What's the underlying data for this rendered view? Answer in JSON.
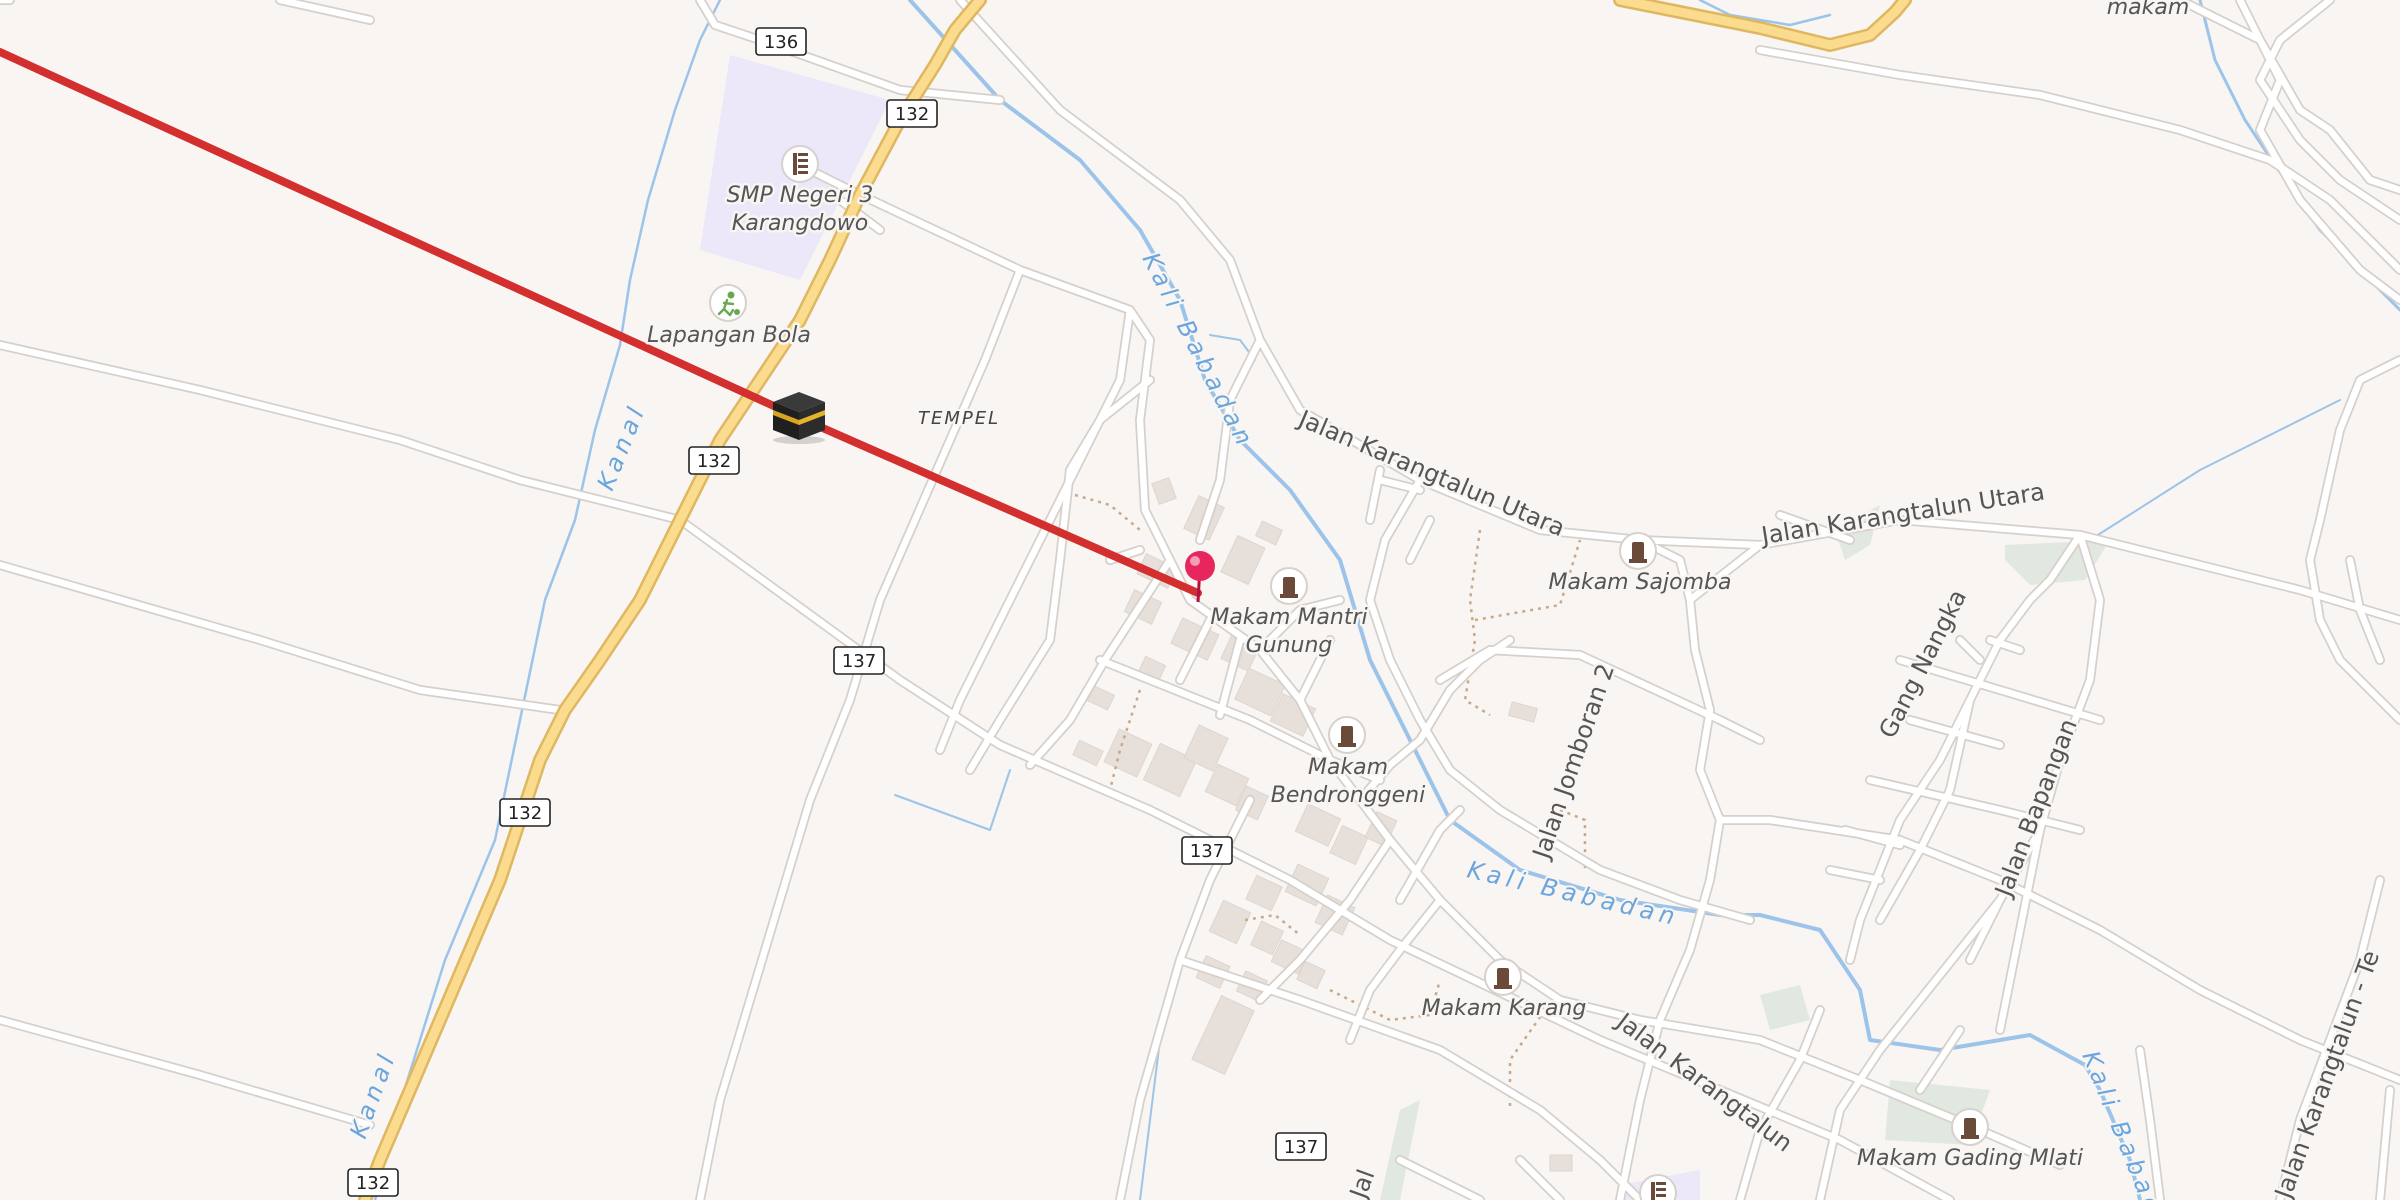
{
  "map": {
    "colors": {
      "background": "#f8f5f2",
      "road": "#ffffff",
      "road_casing": "#d6d0cb",
      "primary_road": "#fbdc8f",
      "primary_road_casing": "#e0b761",
      "water": "#9cc4ea",
      "route_line": "#d32f2f",
      "school_area": "#ece7f9",
      "park_area": "#e1e8df",
      "building": "#e7e0da",
      "pin": "#e8265e"
    },
    "labels": {
      "school": "SMP Negeri 3 Karangdowo",
      "school_line1": "SMP Negeri 3",
      "school_line2": "Karangdowo",
      "field": "Lapangan Bola",
      "tempel": "TEMPEL",
      "makam_mantri_line1": "Makam Mantri",
      "makam_mantri_line2": "Gunung",
      "makam_bendrong_line1": "Makam",
      "makam_bendrong_line2": "Bendronggeni",
      "makam_sajomba": "Makam Sajomba",
      "makam_karang": "Makam Karang",
      "makam_gading": "Makam Gading Mlati",
      "makam_top": "makam",
      "jalan_karangtalun_utara": "Jalan Karangtalun Utara",
      "jalan_jomboran_2": "Jalan Jomboran 2",
      "gang_nangka": "Gang Nangka",
      "jalan_bapangan": "Jalan Bapangan",
      "jalan_karangtalun": "Jalan Karangtalun",
      "jalan_karangtalun_te": "Jalan Karangtalun - Te",
      "jal": "Jal",
      "kali_babadan": "Kali Babadan",
      "kanal": "Kanal"
    },
    "shields": {
      "s136": "136",
      "s132": "132",
      "s137": "137"
    },
    "icons": {
      "kaaba": "kaaba-icon",
      "pin": "location-pin-icon",
      "school": "school-icon",
      "soccer": "soccer-icon",
      "cemetery": "cemetery-icon"
    }
  }
}
